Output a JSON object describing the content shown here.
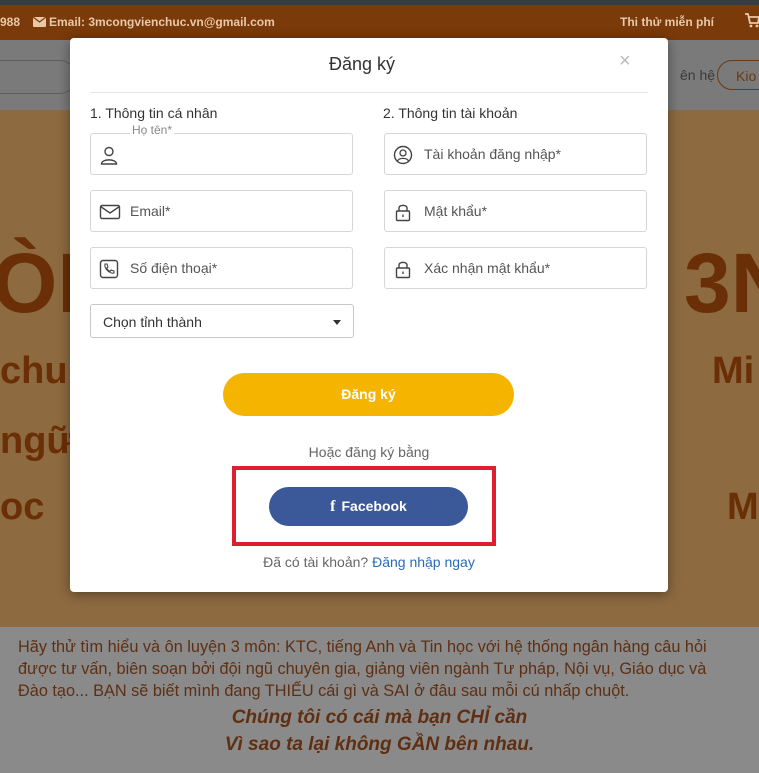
{
  "topbar": {
    "phone_fragment": "988",
    "email_label": "Email: 3mcongvienchuc.vn@gmail.com",
    "trial_link": "Thi thử miễn phí"
  },
  "navbar": {
    "contact_fragment": "ên hệ",
    "button_fragment": "Kio"
  },
  "hero": {
    "big_left": "ÒN",
    "big_right": "3N",
    "line1_left": "chu",
    "line1_right": "Mi",
    "line2_left": "ngữ",
    "line3_left": "oc",
    "line3_right": "M"
  },
  "modal": {
    "title": "Đăng ký",
    "close_symbol": "×",
    "section_personal": "1. Thông tin cá nhân",
    "section_account": "2. Thông tin tài khoản",
    "fields": {
      "fullname_label": "Họ tên*",
      "email_placeholder": "Email*",
      "phone_placeholder": "Số điện thoại*",
      "username_placeholder": "Tài khoản đăng nhập*",
      "password_placeholder": "Mật khẩu*",
      "confirm_placeholder": "Xác nhận mật khẩu*"
    },
    "province_select": "Chọn tỉnh thành",
    "register_button": "Đăng ký",
    "or_label": "Hoặc đăng ký bằng",
    "facebook_button": "Facebook",
    "facebook_glyph": "f",
    "already_text": "Đã có tài khoản?",
    "login_link": "Đăng nhập ngay"
  },
  "bottom": {
    "paragraph": "Hãy thử tìm hiểu và ôn luyện 3 môn: KTC, tiếng Anh và Tin học với hệ thống ngân hàng câu hỏi được tư vấn, biên soạn bởi đội ngũ chuyên gia, giảng viên ngành Tư pháp, Nội vụ, Giáo dục và Đào tạo... BẠN sẽ biết mình đang THIẾU cái gì và SAI ở đâu sau mỗi cú nhấp chuột.",
    "slogan1": "Chúng tôi có cái mà bạn CHỈ cần",
    "slogan2": "Vì sao ta lại không GẦN bên nhau."
  },
  "colors": {
    "accent": "#f5b400",
    "facebook": "#3b5998",
    "highlight": "#e01e2d",
    "link": "#2a6bb5"
  }
}
